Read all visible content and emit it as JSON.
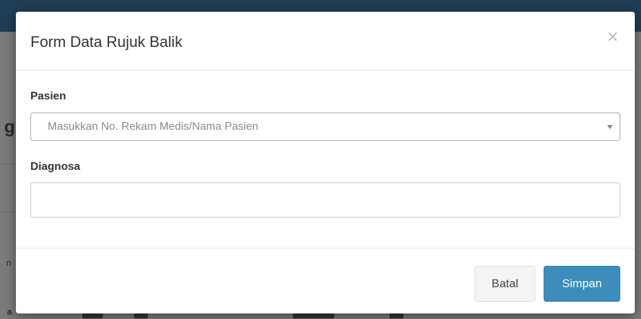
{
  "modal": {
    "title": "Form Data Rujuk Balik",
    "close_glyph": "×",
    "fields": {
      "pasien": {
        "label": "Pasien",
        "placeholder": "Masukkan No. Rekam Medis/Nama Pasien"
      },
      "diagnosa": {
        "label": "Diagnosa",
        "value": ""
      }
    },
    "footer": {
      "cancel_label": "Batal",
      "save_label": "Simpan"
    }
  },
  "colors": {
    "navbar": "#1f3d55",
    "primary_button": "#3c8dbc",
    "default_button": "#f4f4f4"
  },
  "icons": {
    "close": "close-icon",
    "select_arrow": "chevron-down-icon"
  }
}
